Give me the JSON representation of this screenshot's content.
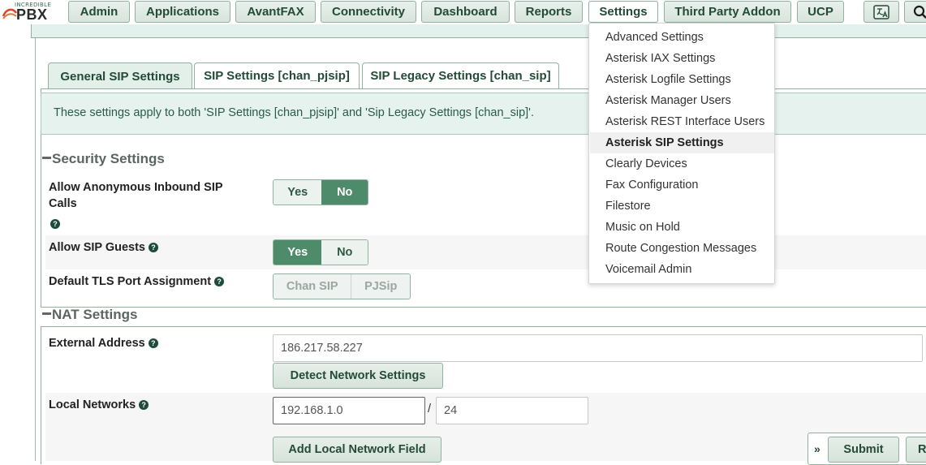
{
  "logo": {
    "small": "INCREDIBLE",
    "big": "PBX"
  },
  "nav": [
    {
      "label": "Admin"
    },
    {
      "label": "Applications"
    },
    {
      "label": "AvantFAX"
    },
    {
      "label": "Connectivity"
    },
    {
      "label": "Dashboard"
    },
    {
      "label": "Reports"
    },
    {
      "label": "Settings"
    },
    {
      "label": "Third Party Addon"
    },
    {
      "label": "UCP"
    }
  ],
  "tabs": [
    {
      "label": "General SIP Settings"
    },
    {
      "label": "SIP Settings [chan_pjsip]"
    },
    {
      "label": "SIP Legacy Settings [chan_sip]"
    }
  ],
  "info": "These settings apply to both 'SIP Settings [chan_pjsip]' and 'Sip Legacy Settings [chan_sip]'.",
  "security": {
    "title": "Security Settings",
    "anon_label": "Allow Anonymous Inbound SIP Calls",
    "anon_yes": "Yes",
    "anon_no": "No",
    "guests_label": "Allow SIP Guests",
    "guests_yes": "Yes",
    "guests_no": "No",
    "tls_label": "Default TLS Port Assignment",
    "tls_chansip": "Chan SIP",
    "tls_pjsip": "PJSip"
  },
  "nat": {
    "title": "NAT Settings",
    "external_label": "External Address",
    "external_value": "186.217.58.227",
    "detect_button": "Detect Network Settings",
    "local_label": "Local Networks",
    "local_ip": "192.168.1.0",
    "slash": "/",
    "local_mask": "24",
    "add_button": "Add Local Network Field"
  },
  "footer": {
    "submit": "Submit",
    "next": "R",
    "arrow": "»"
  },
  "dropdown": [
    "Advanced Settings",
    "Asterisk IAX Settings",
    "Asterisk Logfile Settings",
    "Asterisk Manager Users",
    "Asterisk REST Interface Users",
    "Asterisk SIP Settings",
    "Clearly Devices",
    "Fax Configuration",
    "Filestore",
    "Music on Hold",
    "Route Congestion Messages",
    "Voicemail Admin"
  ],
  "colors": {
    "accent": "#4e8b6b",
    "border": "#8fb39f",
    "info_bg": "#e6f2ee"
  }
}
